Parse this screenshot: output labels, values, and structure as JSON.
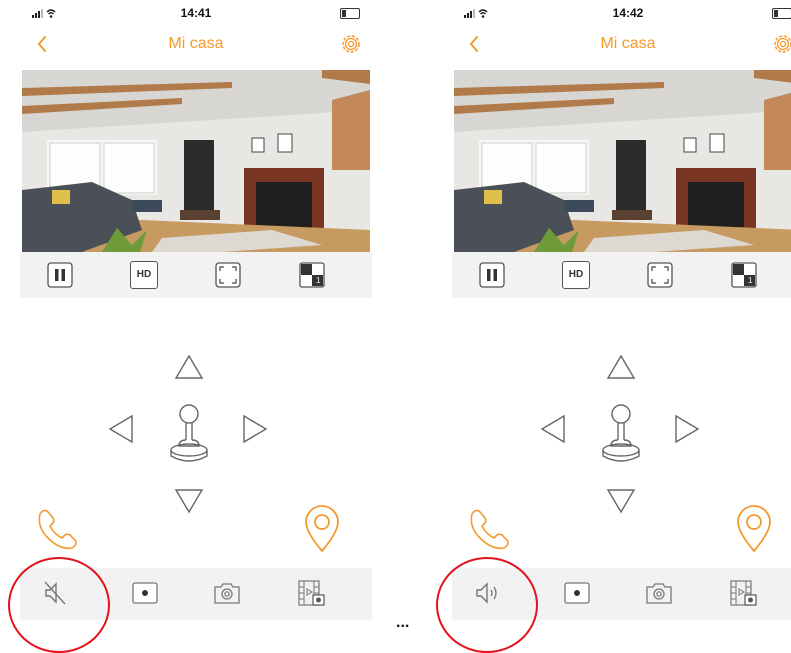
{
  "left_screen": {
    "status": {
      "time": "14:41"
    },
    "header": {
      "title": "Mi casa"
    },
    "video_controls": {
      "quality_label": "HD",
      "channel_label": "1"
    },
    "audio_state": "muted"
  },
  "right_screen": {
    "status": {
      "time": "14:42"
    },
    "header": {
      "title": "Mi casa"
    },
    "video_controls": {
      "quality_label": "HD",
      "channel_label": "1"
    },
    "audio_state": "sound-on"
  },
  "separator": "...",
  "colors": {
    "accent": "#f39a2e",
    "highlight": "#e3121c",
    "icon_gray": "#777777",
    "bar_bg": "#f2f2f2"
  }
}
